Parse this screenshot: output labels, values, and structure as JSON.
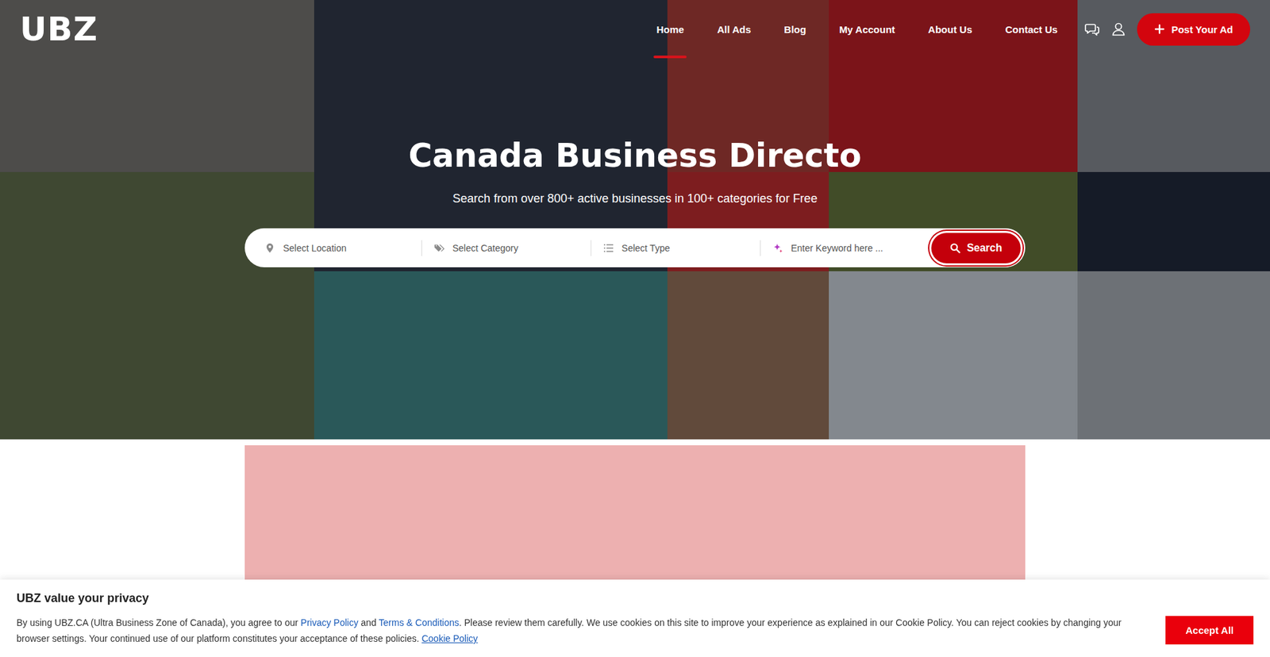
{
  "logo": {
    "text": "UBZ"
  },
  "nav": {
    "items": [
      {
        "label": "Home",
        "selected": true
      },
      {
        "label": "All Ads",
        "selected": false
      },
      {
        "label": "Blog",
        "selected": false
      },
      {
        "label": "My Account",
        "selected": false
      },
      {
        "label": "About Us",
        "selected": false
      },
      {
        "label": "Contact Us",
        "selected": false
      }
    ],
    "post_button": "Post Your Ad"
  },
  "hero": {
    "title": "Canada Business Directo",
    "subtitle": "Search from over 800+ active businesses in 100+ categories for Free"
  },
  "search": {
    "fields": [
      {
        "kind": "location",
        "placeholder": "Select Location"
      },
      {
        "kind": "category",
        "placeholder": "Select Category"
      },
      {
        "kind": "type",
        "placeholder": "Select Type"
      },
      {
        "kind": "keyword",
        "placeholder": "Enter Keyword here ..."
      }
    ],
    "button": "Search"
  },
  "cookie_banner": {
    "title": "UBZ value your privacy",
    "segments": [
      {
        "text": "By using UBZ.CA (Ultra Business Zone of Canada), you agree to our ",
        "link": false
      },
      {
        "text": "Privacy Policy",
        "link": true
      },
      {
        "text": " and ",
        "link": false
      },
      {
        "text": "Terms & Conditions",
        "link": true
      },
      {
        "text": ". Please review them carefully. We use cookies on this site to improve your experience as explained in our Cookie Policy. You can reject cookies by changing your browser settings. Your continued use of our platform constitutes your acceptance of these policies. ",
        "link": false
      },
      {
        "text": "Cookie Policy",
        "link": true
      }
    ],
    "button": "Accept All"
  }
}
